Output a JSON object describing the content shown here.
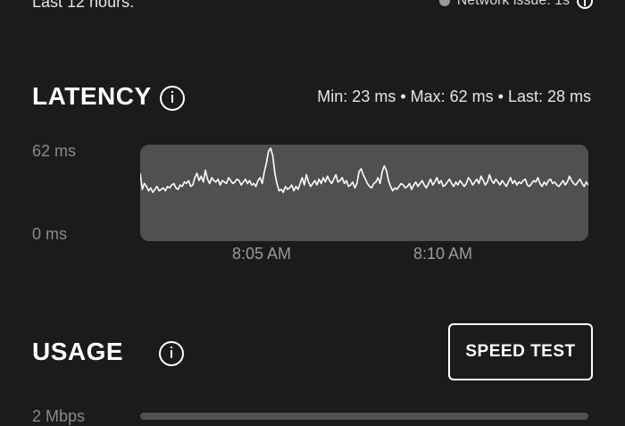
{
  "header": {
    "range_text": "Last 12 hours:",
    "network_issue_text": "Network issue: 1s",
    "network_issue_dot_color": "#9a9a9a"
  },
  "latency": {
    "title": "LATENCY",
    "stats": "Min: 23 ms • Max: 62 ms • Last: 28 ms",
    "y_top_label": "62 ms",
    "y_bottom_label": "0 ms",
    "x_ticks": [
      "8:05 AM",
      "8:10 AM"
    ],
    "chart_data": {
      "type": "line",
      "ylim": [
        0,
        62
      ],
      "values": [
        45,
        34,
        38,
        36,
        33,
        35,
        32,
        34,
        36,
        33,
        34,
        35,
        33,
        36,
        35,
        37,
        38,
        35,
        34,
        37,
        36,
        39,
        38,
        40,
        36,
        37,
        42,
        45,
        40,
        43,
        39,
        47,
        41,
        38,
        42,
        40,
        39,
        41,
        37,
        40,
        39,
        38,
        42,
        40,
        38,
        39,
        41,
        40,
        37,
        39,
        41,
        38,
        40,
        37,
        38,
        36,
        40,
        42,
        38,
        46,
        52,
        60,
        62,
        57,
        45,
        38,
        33,
        34,
        32,
        36,
        34,
        35,
        37,
        33,
        36,
        34,
        38,
        42,
        37,
        44,
        39,
        36,
        38,
        40,
        37,
        41,
        38,
        42,
        39,
        43,
        40,
        38,
        41,
        44,
        39,
        40,
        42,
        38,
        40,
        36,
        37,
        39,
        35,
        38,
        46,
        48,
        44,
        41,
        38,
        36,
        35,
        38,
        39,
        42,
        38,
        46,
        50,
        47,
        40,
        36,
        33,
        35,
        34,
        36,
        38,
        37,
        35,
        36,
        38,
        34,
        37,
        39,
        36,
        38,
        40,
        37,
        35,
        38,
        41,
        37,
        39,
        42,
        38,
        40,
        36,
        37,
        39,
        41,
        38,
        36,
        39,
        37,
        40,
        38,
        36,
        38,
        42,
        40,
        37,
        39,
        41,
        38,
        43,
        40,
        37,
        39,
        44,
        40,
        38,
        41,
        39,
        37,
        40,
        38,
        36,
        39,
        42,
        38,
        40,
        37,
        39,
        38,
        40,
        41,
        37,
        36,
        38,
        40,
        39,
        42,
        38,
        36,
        39,
        37,
        40,
        41,
        38,
        39,
        37,
        36,
        38,
        40,
        37,
        39,
        43,
        40,
        38,
        37,
        39,
        41,
        38,
        36,
        39,
        37
      ],
      "title": "",
      "xlabel": "",
      "ylabel": ""
    },
    "line_color": "#ffffff",
    "plot_bg_color": "#505050"
  },
  "usage": {
    "title": "USAGE",
    "speed_test_label": "SPEED TEST",
    "y_top_label": "2 Mbps"
  },
  "colors": {
    "background": "#1b1b1b",
    "muted_text": "#8a8a8a"
  }
}
